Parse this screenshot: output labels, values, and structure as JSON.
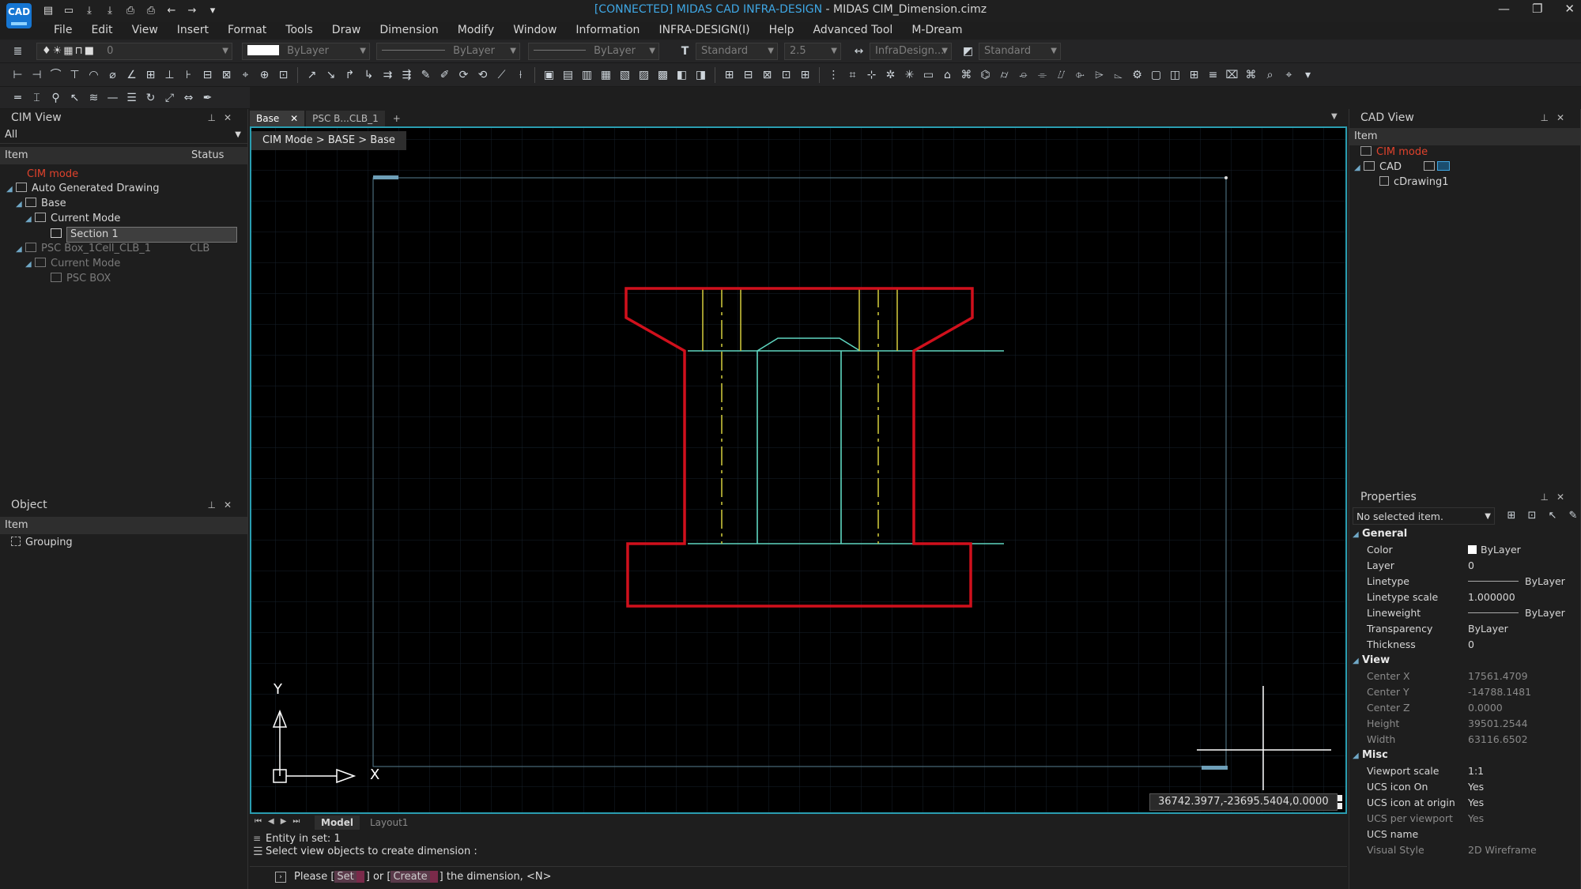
{
  "app": {
    "icon_label": "CAD",
    "status": "[CONNECTED] MIDAS CAD INFRA-DESIGN",
    "title": " - MIDAS CIM_Dimension.cimz",
    "window_buttons": [
      "—",
      "❐",
      "✕"
    ]
  },
  "menu": [
    "File",
    "Edit",
    "View",
    "Insert",
    "Format",
    "Tools",
    "Draw",
    "Dimension",
    "Modify",
    "Window",
    "Information",
    "INFRA-DESIGN(I)",
    "Help",
    "Advanced Tool",
    "M-Dream"
  ],
  "toolbar": {
    "layer_value": "0",
    "color_value": "ByLayer",
    "linetype_value": "ByLayer",
    "lineweight_value": "ByLayer",
    "textstyle_value": "Standard",
    "textheight_value": "2.5",
    "dimstyle_value": "InfraDesign...",
    "tablestyle_value": "Standard"
  },
  "cim_view": {
    "title": "CIM View",
    "filter": "All",
    "col_item": "Item",
    "col_status": "Status",
    "rows": [
      {
        "label": "CIM mode",
        "status": ""
      },
      {
        "label": "Auto Generated Drawing",
        "status": ""
      },
      {
        "label": "Base",
        "status": ""
      },
      {
        "label": "Current Mode",
        "status": ""
      },
      {
        "label": "Section 1",
        "status": ""
      },
      {
        "label": "PSC Box_1Cell_CLB_1",
        "status": "CLB"
      },
      {
        "label": "Current Mode",
        "status": ""
      },
      {
        "label": "PSC BOX",
        "status": ""
      }
    ]
  },
  "object_panel": {
    "title": "Object",
    "col_item": "Item",
    "rows": [
      "Grouping"
    ]
  },
  "doc_tabs": [
    {
      "label": "Base",
      "close": "✕"
    },
    {
      "label": "PSC B...CLB_1",
      "close": ""
    },
    {
      "label": "+",
      "close": ""
    }
  ],
  "breadcrumb": "CIM Mode > BASE > Base",
  "ucs": {
    "x_label": "X",
    "y_label": "Y"
  },
  "coordinates": "36742.3977,-23695.5404,0.0000",
  "layout_tabs": [
    "Model",
    "Layout1"
  ],
  "command": {
    "line1": "Entity in set: 1",
    "line2": "Select view objects to create dimension :",
    "prompt_pre": "Please [",
    "opt1": "Set",
    "prompt_mid": "] or [",
    "opt2": "Create",
    "prompt_post": "] the dimension, <N>"
  },
  "cad_view": {
    "title": "CAD View",
    "col_item": "Item",
    "rows": [
      "CIM mode",
      "CAD",
      "cDrawing1"
    ]
  },
  "properties": {
    "title": "Properties",
    "selection": "No selected item.",
    "sections": [
      {
        "name": "General",
        "rows": [
          {
            "k": "Color",
            "v": "ByLayer"
          },
          {
            "k": "Layer",
            "v": "0"
          },
          {
            "k": "Linetype",
            "v": "ByLayer"
          },
          {
            "k": "Linetype scale",
            "v": "1.000000"
          },
          {
            "k": "Lineweight",
            "v": "ByLayer"
          },
          {
            "k": "Transparency",
            "v": "ByLayer"
          },
          {
            "k": "Thickness",
            "v": "0"
          }
        ]
      },
      {
        "name": "View",
        "rows": [
          {
            "k": "Center X",
            "v": "17561.4709"
          },
          {
            "k": "Center Y",
            "v": "-14788.1481"
          },
          {
            "k": "Center Z",
            "v": "0.0000"
          },
          {
            "k": "Height",
            "v": "39501.2544"
          },
          {
            "k": "Width",
            "v": "63116.6502"
          }
        ]
      },
      {
        "name": "Misc",
        "rows": [
          {
            "k": "Viewport scale",
            "v": "1:1"
          },
          {
            "k": "UCS icon On",
            "v": "Yes"
          },
          {
            "k": "UCS icon at origin",
            "v": "Yes"
          },
          {
            "k": "UCS per viewport",
            "v": "Yes"
          },
          {
            "k": "UCS name",
            "v": ""
          },
          {
            "k": "Visual Style",
            "v": "2D Wireframe"
          }
        ]
      }
    ]
  },
  "colors": {
    "accent": "#2a9db0",
    "section_outline": "#d0101c",
    "inner_lines": "#5fd6c0",
    "axis_lines": "#c8c23a",
    "highlight_red": "#e0422c"
  }
}
